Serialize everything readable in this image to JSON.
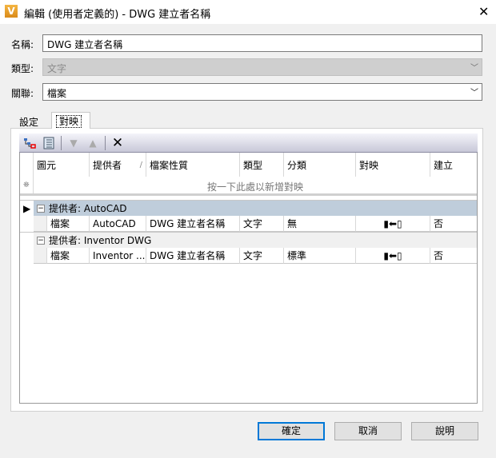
{
  "window": {
    "title": "編輯 (使用者定義的) - DWG 建立者名稱",
    "logo": "V"
  },
  "form": {
    "name_label": "名稱:",
    "name_value": "DWG 建立者名稱",
    "type_label": "類型:",
    "type_value": "文字",
    "assoc_label": "關聯:",
    "assoc_value": "檔案"
  },
  "tabs": [
    {
      "label": "設定"
    },
    {
      "label": "對映"
    }
  ],
  "grid": {
    "columns": [
      "圖元",
      "提供者",
      "檔案性質",
      "類型",
      "分類",
      "對映",
      "建立"
    ],
    "sort_indicator": "/",
    "new_row_hint": "按一下此處以新增對映",
    "new_row_marker": "❊",
    "groups": [
      {
        "label": "提供者: AutoCAD",
        "rows": [
          [
            "檔案",
            "AutoCAD",
            "DWG 建立者名稱",
            "文字",
            "無",
            "",
            "否"
          ]
        ]
      },
      {
        "label": "提供者: Inventor DWG",
        "rows": [
          [
            "檔案",
            "Inventor ...",
            "DWG 建立者名稱",
            "文字",
            "標準",
            "",
            "否"
          ]
        ]
      }
    ]
  },
  "buttons": {
    "ok": "確定",
    "cancel": "取消",
    "help": "說明"
  }
}
